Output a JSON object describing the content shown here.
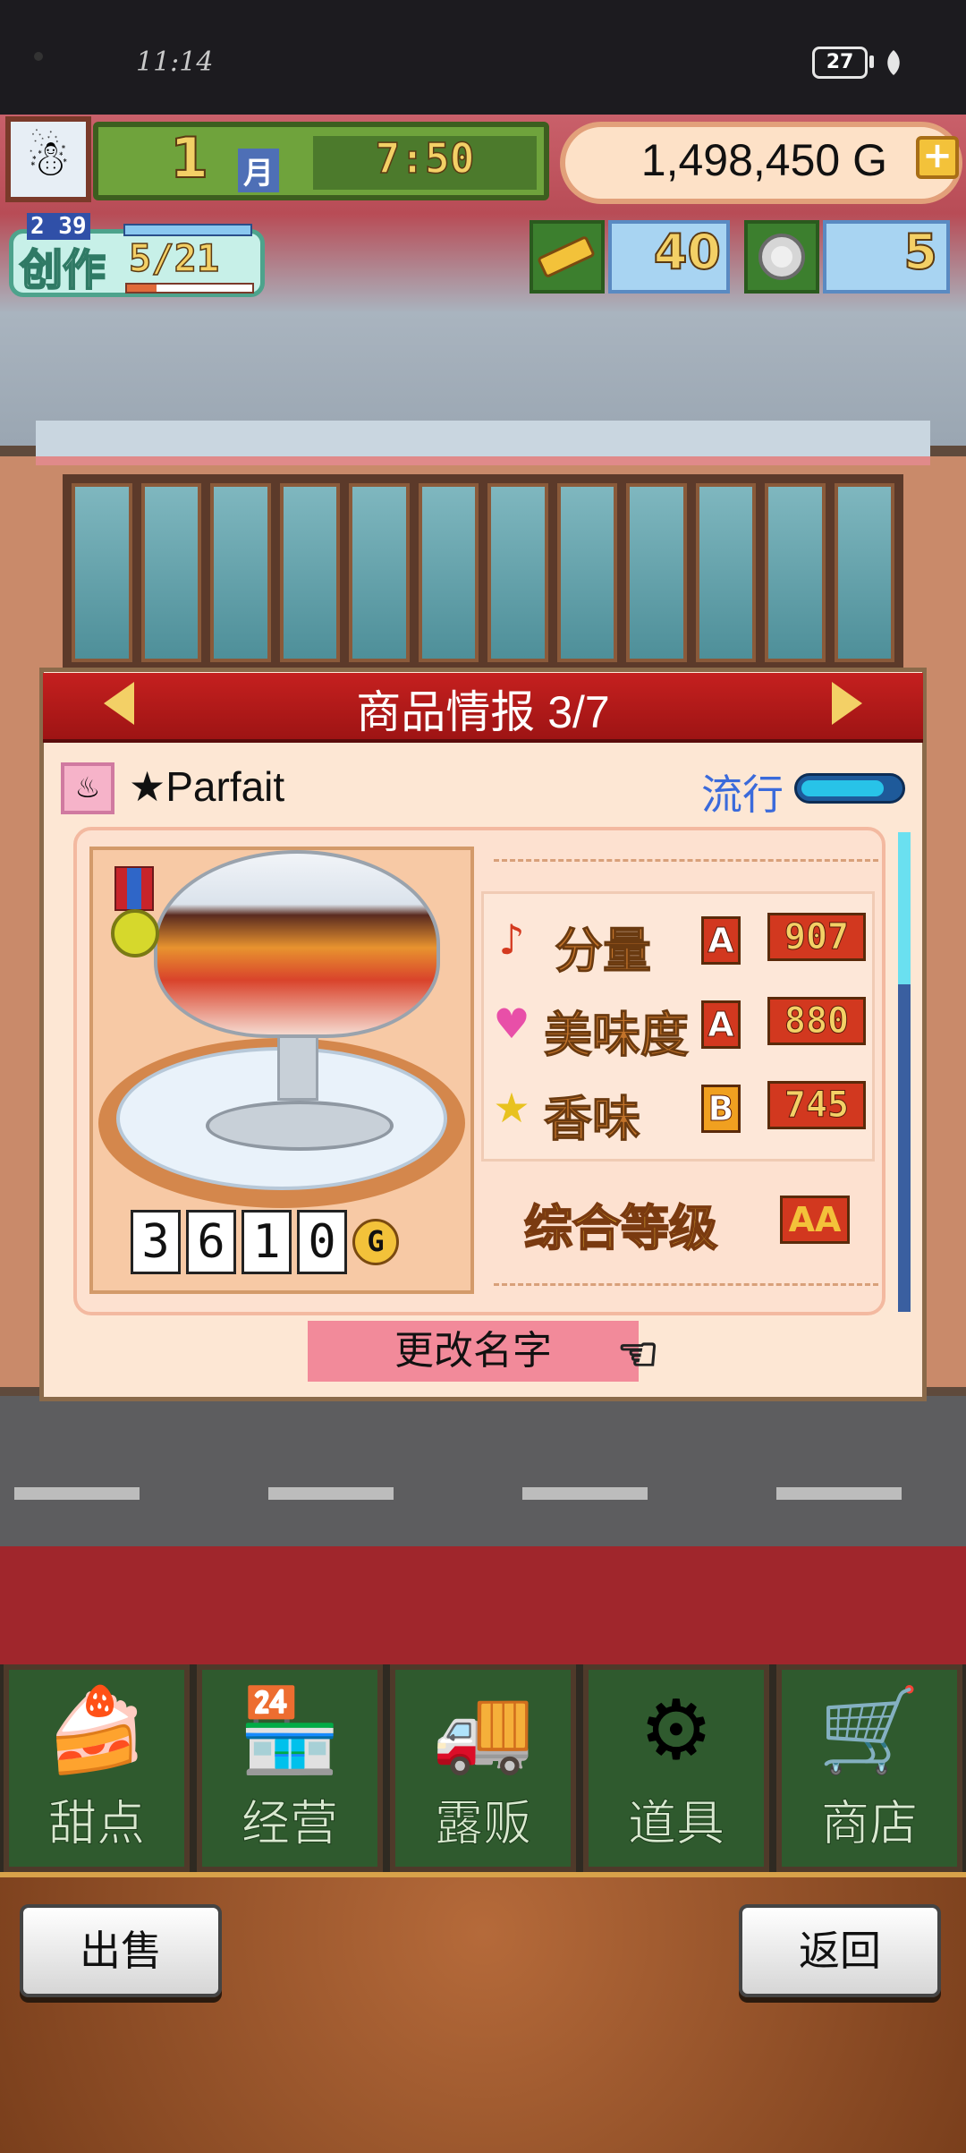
{
  "status_bar": {
    "time": "11:14",
    "battery": "27"
  },
  "hud": {
    "month_number": "1",
    "month_label": "月",
    "clock": "7:50",
    "gold": "1,498,450 G",
    "add_gold_symbol": "+",
    "create": {
      "label": "创作",
      "timer": "2 39",
      "count": "5/21",
      "progress": 0.24
    },
    "resources": [
      {
        "name": "gold-ticket",
        "value": "40"
      },
      {
        "name": "silver-medal",
        "value": "5"
      }
    ]
  },
  "panel": {
    "title": "商品情报 3/7",
    "product_name": "★Parfait",
    "trend_label": "流行",
    "trend_level": 0.85,
    "price_digits": [
      "3",
      "6",
      "1",
      "0"
    ],
    "price_unit": "G",
    "stats": [
      {
        "icon": "music-note-icon",
        "symbol": "♪",
        "label": "分量",
        "grade": "A",
        "value": "907"
      },
      {
        "icon": "heart-icon",
        "symbol": "♥",
        "label": "美味度",
        "grade": "A",
        "value": "880"
      },
      {
        "icon": "star-icon",
        "symbol": "★",
        "label": "香味",
        "grade": "B",
        "value": "745"
      }
    ],
    "overall_label": "综合等级",
    "overall_grade": "AA",
    "rename_label": "更改名字"
  },
  "nav": [
    {
      "label": "甜点",
      "icon": "cake-icon",
      "glyph": "🍰"
    },
    {
      "label": "经营",
      "icon": "shop-icon",
      "glyph": "🏪"
    },
    {
      "label": "露贩",
      "icon": "food-truck-icon",
      "glyph": "🚚"
    },
    {
      "label": "道具",
      "icon": "items-bag-icon",
      "glyph": "⚙"
    },
    {
      "label": "商店",
      "icon": "shopping-cart-icon",
      "glyph": "🛒"
    }
  ],
  "buttons": {
    "sell": "出售",
    "back": "返回"
  },
  "colors": {
    "panel_header": "#c5201f",
    "rename": "#f28a9a",
    "trend": "#3a6adb"
  }
}
